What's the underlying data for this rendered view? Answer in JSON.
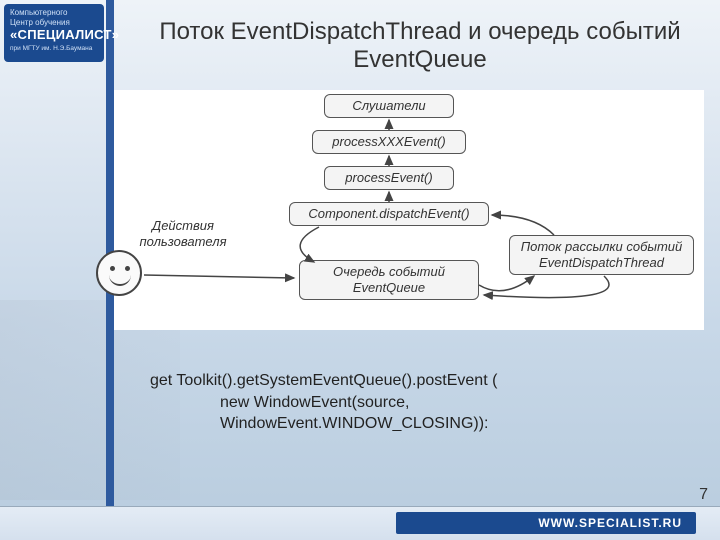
{
  "logo": {
    "line1": "Компьютерного",
    "line2": "Центр обучения",
    "brand": "«СПЕЦИАЛИСТ»",
    "sub": "при МГТУ им. Н.Э.Баумана"
  },
  "title": "Поток EventDispatchThread и очередь событий EventQueue",
  "diagram": {
    "user_label": "Действия пользователя",
    "boxes": {
      "listeners": "Слушатели",
      "processXXX": "processXXXEvent()",
      "processEvent": "processEvent()",
      "dispatch": "Component.dispatchEvent()",
      "queue": "Очередь событий EventQueue",
      "thread": "Поток рассылки событий EventDispatchThread"
    }
  },
  "code": {
    "l1": "get Toolkit().getSystemEventQueue().postEvent (",
    "l2": "new WindowEvent(source,",
    "l3": "WindowEvent.WINDOW_CLOSING)):"
  },
  "footer_url": "WWW.SPECIALIST.RU",
  "page_number": "7"
}
